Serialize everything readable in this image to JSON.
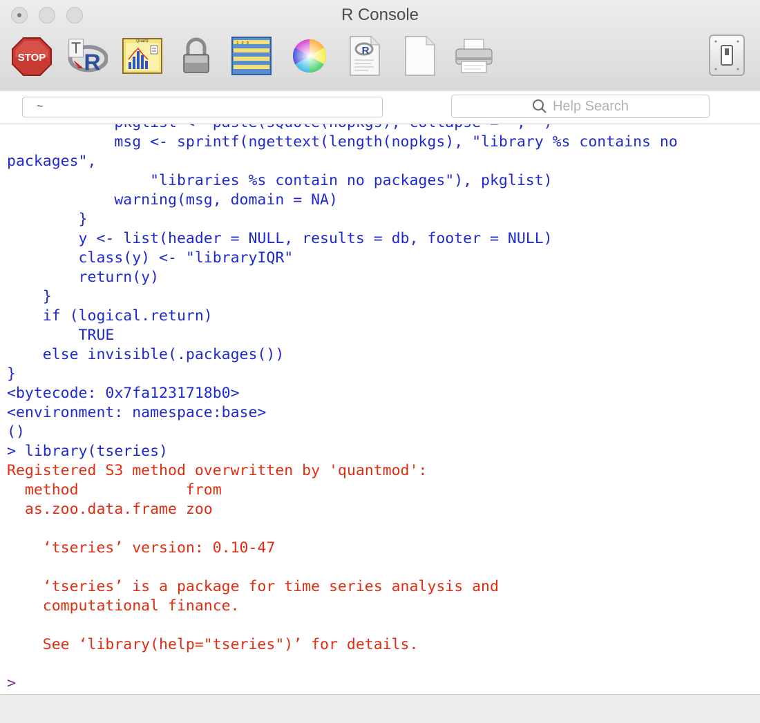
{
  "window": {
    "title": "R Console"
  },
  "toolbar": {
    "tools": [
      {
        "name": "stop-icon",
        "label": "STOP"
      },
      {
        "name": "r-source-icon"
      },
      {
        "name": "quartz-icon",
        "label": "Quartz"
      },
      {
        "name": "lock-icon"
      },
      {
        "name": "data-editor-icon"
      },
      {
        "name": "color-wheel-icon"
      },
      {
        "name": "r-document-icon"
      },
      {
        "name": "new-document-icon"
      },
      {
        "name": "print-icon"
      }
    ]
  },
  "fields": {
    "working_dir": "~",
    "help_search_placeholder": "Help Search"
  },
  "console": {
    "lines": [
      {
        "text": "            pkglist <- paste(sQuote(nopkgs), collapse = \", \")",
        "color": "blue"
      },
      {
        "text": "            msg <- sprintf(ngettext(length(nopkgs), \"library %s contains no",
        "color": "blue"
      },
      {
        "text": "packages\",",
        "color": "blue"
      },
      {
        "text": "                \"libraries %s contain no packages\"), pkglist)",
        "color": "blue"
      },
      {
        "text": "            warning(msg, domain = NA)",
        "color": "blue"
      },
      {
        "text": "        }",
        "color": "blue"
      },
      {
        "text": "        y <- list(header = NULL, results = db, footer = NULL)",
        "color": "blue"
      },
      {
        "text": "        class(y) <- \"libraryIQR\"",
        "color": "blue"
      },
      {
        "text": "        return(y)",
        "color": "blue"
      },
      {
        "text": "    }",
        "color": "blue"
      },
      {
        "text": "    if (logical.return)",
        "color": "blue"
      },
      {
        "text": "        TRUE",
        "color": "blue"
      },
      {
        "text": "    else invisible(.packages())",
        "color": "blue"
      },
      {
        "text": "}",
        "color": "blue"
      },
      {
        "text": "<bytecode: 0x7fa1231718b0>",
        "color": "blue"
      },
      {
        "text": "<environment: namespace:base>",
        "color": "blue"
      },
      {
        "text": "()",
        "color": "blue"
      },
      {
        "text": "> library(tseries)",
        "color": "blue"
      },
      {
        "text": "Registered S3 method overwritten by 'quantmod':",
        "color": "red"
      },
      {
        "text": "  method            from",
        "color": "red"
      },
      {
        "text": "  as.zoo.data.frame zoo",
        "color": "red"
      },
      {
        "text": "",
        "color": "red"
      },
      {
        "text": "    ‘tseries’ version: 0.10-47",
        "color": "red"
      },
      {
        "text": "",
        "color": "red"
      },
      {
        "text": "    ‘tseries’ is a package for time series analysis and",
        "color": "red"
      },
      {
        "text": "    computational finance.",
        "color": "red"
      },
      {
        "text": "",
        "color": "red"
      },
      {
        "text": "    See ‘library(help=\"tseries\")’ for details.",
        "color": "red"
      },
      {
        "text": "",
        "color": "red"
      },
      {
        "text": ">",
        "color": "purple"
      }
    ]
  },
  "colors": {
    "input": "#1f2bd1",
    "output": "#e12d12",
    "prompt": "#7e2d8f"
  }
}
